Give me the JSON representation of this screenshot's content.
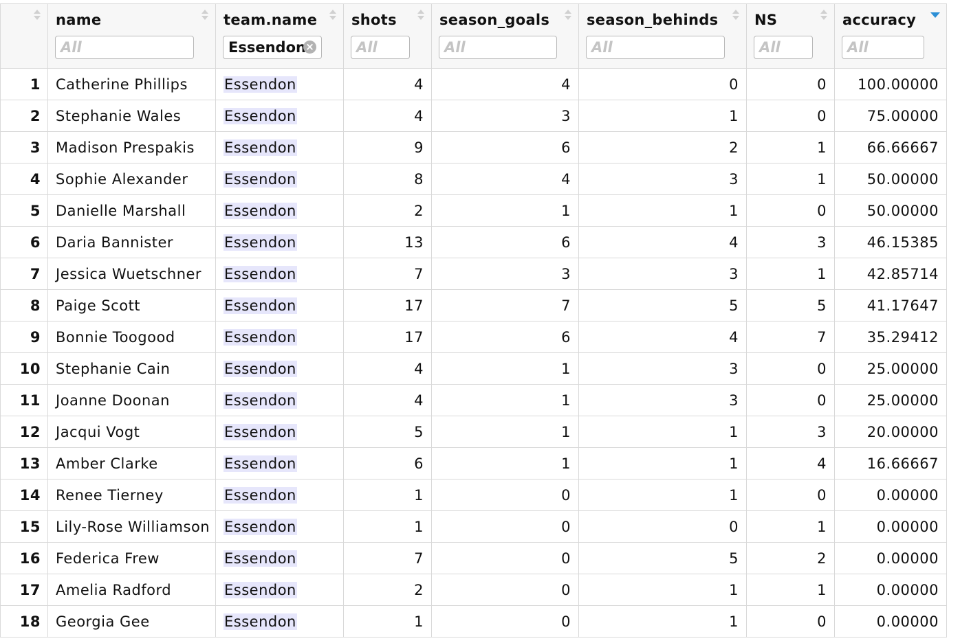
{
  "columns": [
    {
      "key": "rownum",
      "label": "",
      "filter": null
    },
    {
      "key": "name",
      "label": "name",
      "filter": "All",
      "filter_active": false
    },
    {
      "key": "team_name",
      "label": "team.name",
      "filter": "Essendon",
      "filter_active": true
    },
    {
      "key": "shots",
      "label": "shots",
      "filter": "All",
      "filter_active": false
    },
    {
      "key": "season_goals",
      "label": "season_goals",
      "filter": "All",
      "filter_active": false
    },
    {
      "key": "season_behinds",
      "label": "season_behinds",
      "filter": "All",
      "filter_active": false
    },
    {
      "key": "NS",
      "label": "NS",
      "filter": "All",
      "filter_active": false
    },
    {
      "key": "accuracy",
      "label": "accuracy",
      "filter": "All",
      "filter_active": false,
      "sorted": "descending"
    }
  ],
  "rows": [
    [
      "1",
      "Catherine Phillips",
      "Essendon",
      "4",
      "4",
      "0",
      "0",
      "100.00000"
    ],
    [
      "2",
      "Stephanie Wales",
      "Essendon",
      "4",
      "3",
      "1",
      "0",
      "75.00000"
    ],
    [
      "3",
      "Madison Prespakis",
      "Essendon",
      "9",
      "6",
      "2",
      "1",
      "66.66667"
    ],
    [
      "4",
      "Sophie Alexander",
      "Essendon",
      "8",
      "4",
      "3",
      "1",
      "50.00000"
    ],
    [
      "5",
      "Danielle Marshall",
      "Essendon",
      "2",
      "1",
      "1",
      "0",
      "50.00000"
    ],
    [
      "6",
      "Daria Bannister",
      "Essendon",
      "13",
      "6",
      "4",
      "3",
      "46.15385"
    ],
    [
      "7",
      "Jessica Wuetschner",
      "Essendon",
      "7",
      "3",
      "3",
      "1",
      "42.85714"
    ],
    [
      "8",
      "Paige Scott",
      "Essendon",
      "17",
      "7",
      "5",
      "5",
      "41.17647"
    ],
    [
      "9",
      "Bonnie Toogood",
      "Essendon",
      "17",
      "6",
      "4",
      "7",
      "35.29412"
    ],
    [
      "10",
      "Stephanie Cain",
      "Essendon",
      "4",
      "1",
      "3",
      "0",
      "25.00000"
    ],
    [
      "11",
      "Joanne Doonan",
      "Essendon",
      "4",
      "1",
      "3",
      "0",
      "25.00000"
    ],
    [
      "12",
      "Jacqui Vogt",
      "Essendon",
      "5",
      "1",
      "1",
      "3",
      "20.00000"
    ],
    [
      "13",
      "Amber Clarke",
      "Essendon",
      "6",
      "1",
      "1",
      "4",
      "16.66667"
    ],
    [
      "14",
      "Renee Tierney",
      "Essendon",
      "1",
      "0",
      "1",
      "0",
      "0.00000"
    ],
    [
      "15",
      "Lily-Rose Williamson",
      "Essendon",
      "1",
      "0",
      "0",
      "1",
      "0.00000"
    ],
    [
      "16",
      "Federica Frew",
      "Essendon",
      "7",
      "0",
      "5",
      "2",
      "0.00000"
    ],
    [
      "17",
      "Amelia Radford",
      "Essendon",
      "2",
      "0",
      "1",
      "1",
      "0.00000"
    ],
    [
      "18",
      "Georgia Gee",
      "Essendon",
      "1",
      "0",
      "1",
      "0",
      "0.00000"
    ]
  ],
  "colors": {
    "highlight": "#e6e6fb",
    "sort_active": "#2c8fd6"
  }
}
